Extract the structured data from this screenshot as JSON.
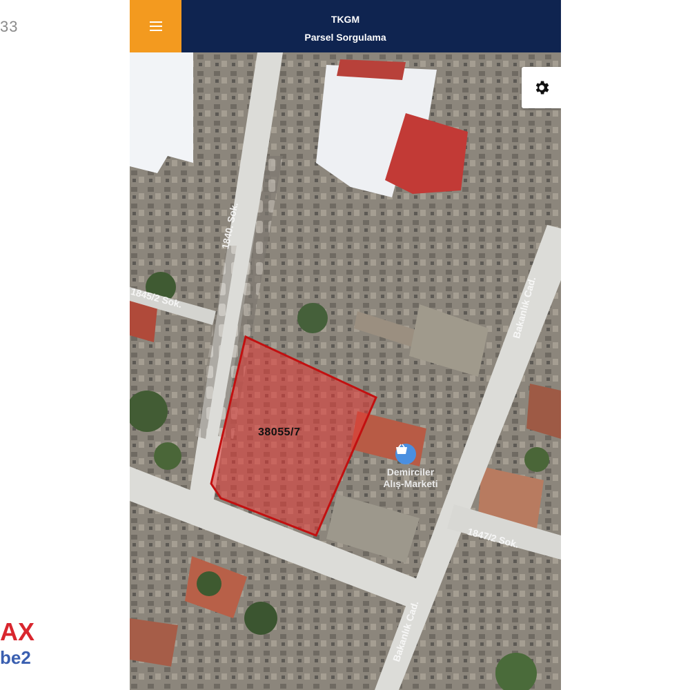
{
  "background": {
    "left_fragment_text": "33",
    "logo_fragment_line1": "AX",
    "logo_fragment_line2": "be2"
  },
  "header": {
    "title": "TKGM",
    "subtitle": "Parsel Sorgulama",
    "menu_icon": "hamburger-icon",
    "menu_button_color": "#f39a1f",
    "bar_color": "#0f2450"
  },
  "map": {
    "settings_icon": "gear-icon",
    "parcel": {
      "label": "38055/7",
      "fill_color": "#e53935",
      "border_color": "#c21010"
    },
    "streets": [
      {
        "name": "1840. Sok."
      },
      {
        "name": "1845/2 Sok."
      },
      {
        "name": "Bakanlık Cad."
      },
      {
        "name": "1847/2 Sok."
      },
      {
        "name": "Bakanlık Cad."
      }
    ],
    "poi": {
      "icon": "shopping-basket-icon",
      "line1": "Demirciler",
      "line2": "Alış-Marketi"
    }
  }
}
